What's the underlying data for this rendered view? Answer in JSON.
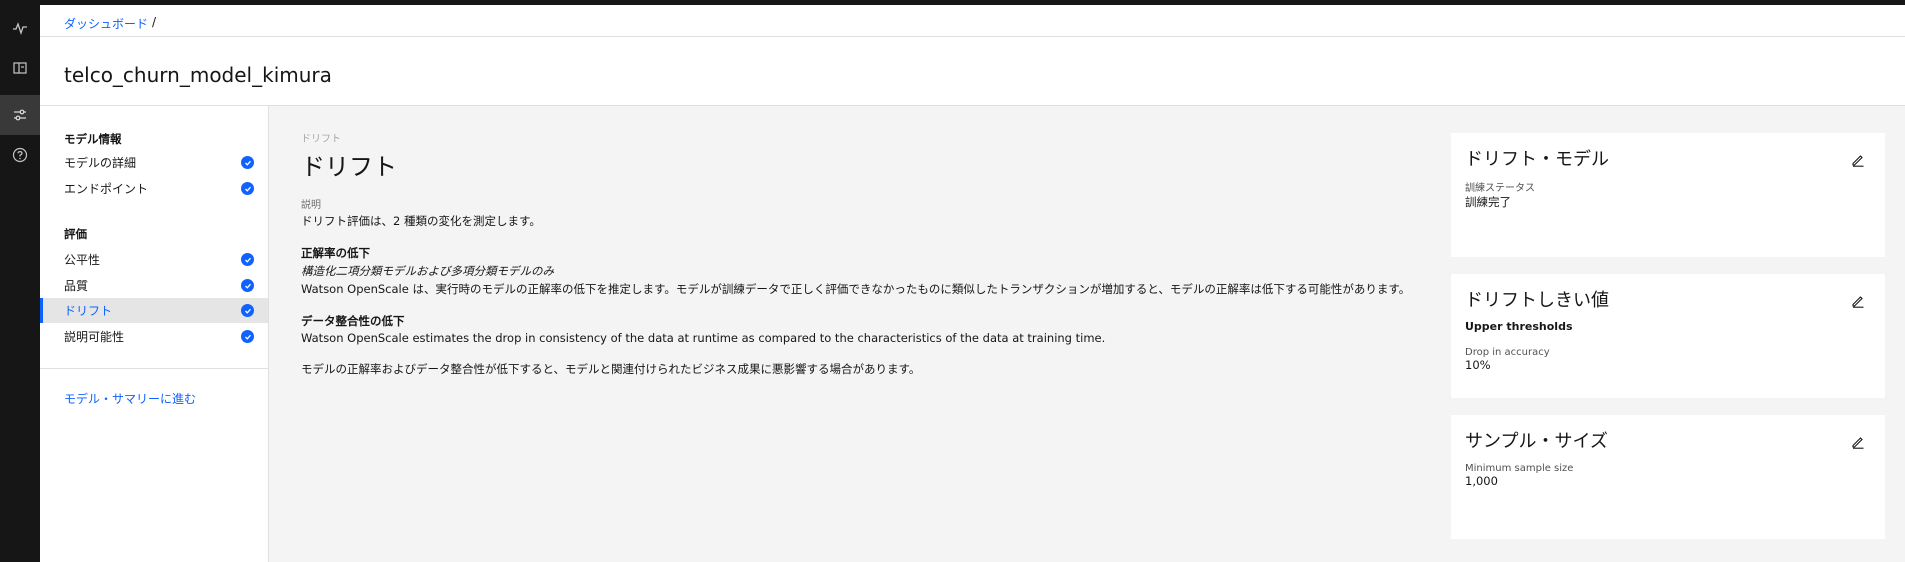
{
  "rail": {
    "icons": [
      "activity-icon",
      "catalog-icon",
      "settings-adjust-icon",
      "help-icon"
    ]
  },
  "breadcrumb": {
    "link": "ダッシュボード",
    "separator": "/"
  },
  "page": {
    "title": "telco_churn_model_kimura"
  },
  "sidenav": {
    "group1": {
      "heading": "モデル情報",
      "items": [
        {
          "label": "モデルの詳細",
          "done": true
        },
        {
          "label": "エンドポイント",
          "done": true
        }
      ]
    },
    "group2": {
      "heading": "評価",
      "items": [
        {
          "label": "公平性",
          "done": true
        },
        {
          "label": "品質",
          "done": true
        },
        {
          "label": "ドリフト",
          "done": true,
          "active": true
        },
        {
          "label": "説明可能性",
          "done": true
        }
      ]
    },
    "summary_link": "モデル・サマリーに進む"
  },
  "main": {
    "eyebrow": "ドリフト",
    "title": "ドリフト",
    "description_label": "説明",
    "description": "ドリフト評価は、2 種類の変化を測定します。",
    "section1": {
      "title": "正解率の低下",
      "subtitle": "構造化二項分類モデルおよび多項分類モデルのみ",
      "body": "Watson OpenScale は、実行時のモデルの正解率の低下を推定します。モデルが訓練データで正しく評価できなかったものに類似したトランザクションが増加すると、モデルの正解率は低下する可能性があります。"
    },
    "section2": {
      "title": "データ整合性の低下",
      "body": "Watson OpenScale estimates the drop in consistency of the data at runtime as compared to the characteristics of the data at training time."
    },
    "footer": "モデルの正解率およびデータ整合性が低下すると、モデルと関連付けられたビジネス成果に悪影響する場合があります。"
  },
  "cards": {
    "drift_model": {
      "title": "ドリフト・モデル",
      "status_label": "訓練ステータス",
      "status_value": "訓練完了"
    },
    "thresholds": {
      "title": "ドリフトしきい値",
      "upper_label": "Upper thresholds",
      "drop_label": "Drop in accuracy",
      "drop_value": "10%"
    },
    "sample_size": {
      "title": "サンプル・サイズ",
      "min_label": "Minimum sample size",
      "min_value": "1,000"
    }
  },
  "colors": {
    "accent": "#0f62fe",
    "rail": "#161616",
    "background": "#f4f4f4"
  }
}
